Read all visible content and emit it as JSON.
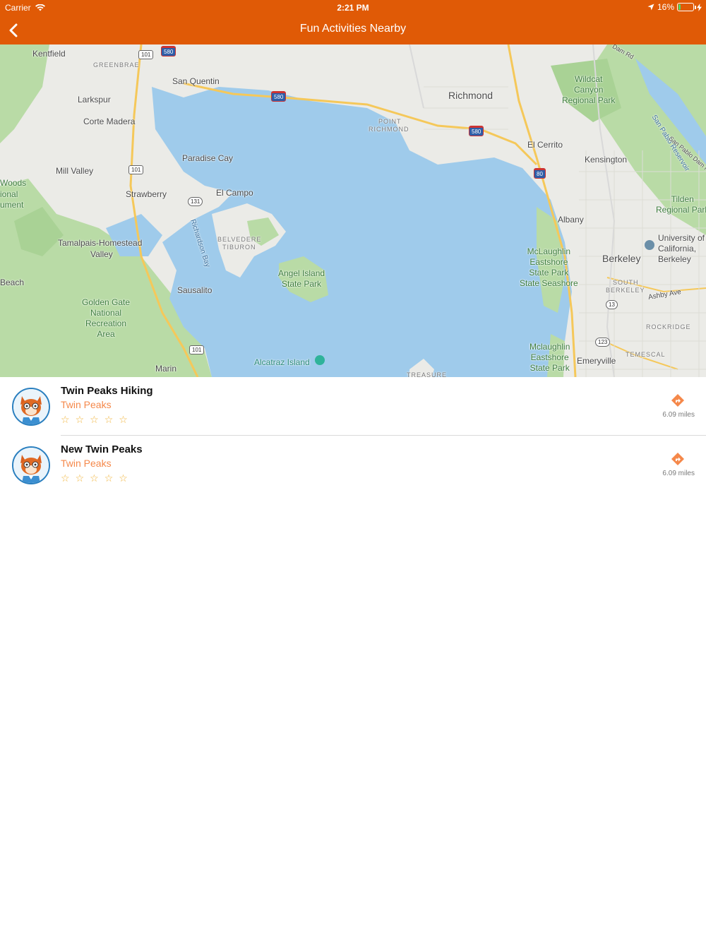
{
  "status_bar": {
    "carrier": "Carrier",
    "time": "2:21 PM",
    "battery": "16%",
    "battery_level": 0.16
  },
  "nav": {
    "title": "Fun Activities Nearby",
    "back_icon": "chevron-left-icon"
  },
  "map": {
    "labels": {
      "kentfield": "Kentfield",
      "greenbrae": "GREENBRAE",
      "san_quentin": "San Quentin",
      "larkspur": "Larkspur",
      "corte_madera": "Corte Madera",
      "paradise_cay": "Paradise Cay",
      "mill_valley": "Mill Valley",
      "strawberry": "Strawberry",
      "el_campo": "El Campo",
      "woods": "Woods",
      "ional": "ional",
      "ument": "ument",
      "tamalpais": "Tamalpais-Homestead",
      "valley": "Valley",
      "belvedere": "BELVEDERE",
      "tiburon": "TIBURON",
      "richardson_bay": "Richardson Bay",
      "beach": "Beach",
      "sausalito": "Sausalito",
      "angel_island_1": "Angel Island",
      "angel_island_2": "State Park",
      "ggnra_1": "Golden Gate",
      "ggnra_2": "National",
      "ggnra_3": "Recreation",
      "ggnra_4": "Area",
      "marin": "Marin",
      "alcatraz": "Alcatraz Island",
      "treasure": "TREASURE",
      "richmond": "Richmond",
      "point_richmond_1": "POINT",
      "point_richmond_2": "RICHMOND",
      "el_cerrito": "El Cerrito",
      "kensington": "Kensington",
      "wildcat_1": "Wildcat",
      "wildcat_2": "Canyon",
      "wildcat_3": "Regional Park",
      "tilden_1": "Tilden",
      "tilden_2": "Regional Park",
      "albany": "Albany",
      "berkeley": "Berkeley",
      "uc_1": "University of",
      "uc_2": "California,",
      "uc_3": "Berkeley",
      "mclaughlin_1": "McLaughlin",
      "mclaughlin_2": "Eastshore",
      "mclaughlin_3": "State Park",
      "mclaughlin_4": "State Seashore",
      "south_berkeley_1": "SOUTH",
      "south_berkeley_2": "BERKELEY",
      "ashby": "Ashby Ave",
      "rockridge": "ROCKRIDGE",
      "temescal": "TEMESCAL",
      "mclaughlin_b_1": "Mclaughlin",
      "mclaughlin_b_2": "Eastshore",
      "mclaughlin_b_3": "State Park",
      "emeryville": "Emeryville",
      "san_pablo_res": "San Pablo Reservoir",
      "dam_rd": "Dam Rd",
      "san_pablo_dam_rd": "San Pablo Dam R"
    },
    "shields": {
      "us101_a": "101",
      "us101_b": "101",
      "us101_c": "101",
      "i580_a": "580",
      "i580_b": "580",
      "i580_c": "580",
      "i80": "80",
      "ca131": "131",
      "ca13": "13",
      "ca123": "123"
    }
  },
  "activities": [
    {
      "title": "Twin Peaks Hiking",
      "location": "Twin Peaks",
      "rating": 0,
      "stars": [
        "☆",
        "☆",
        "☆",
        "☆",
        "☆"
      ],
      "distance": "6.09 miles",
      "icon": "directions-icon"
    },
    {
      "title": "New Twin Peaks",
      "location": "Twin Peaks",
      "rating": 0,
      "stars": [
        "☆",
        "☆",
        "☆",
        "☆",
        "☆"
      ],
      "distance": "6.09 miles",
      "icon": "directions-icon"
    }
  ],
  "colors": {
    "header": "#E05A06",
    "accent": "#F5884A",
    "star": "#F0B43C",
    "water": "#9FCBEB",
    "park": "#B5DCA0"
  }
}
